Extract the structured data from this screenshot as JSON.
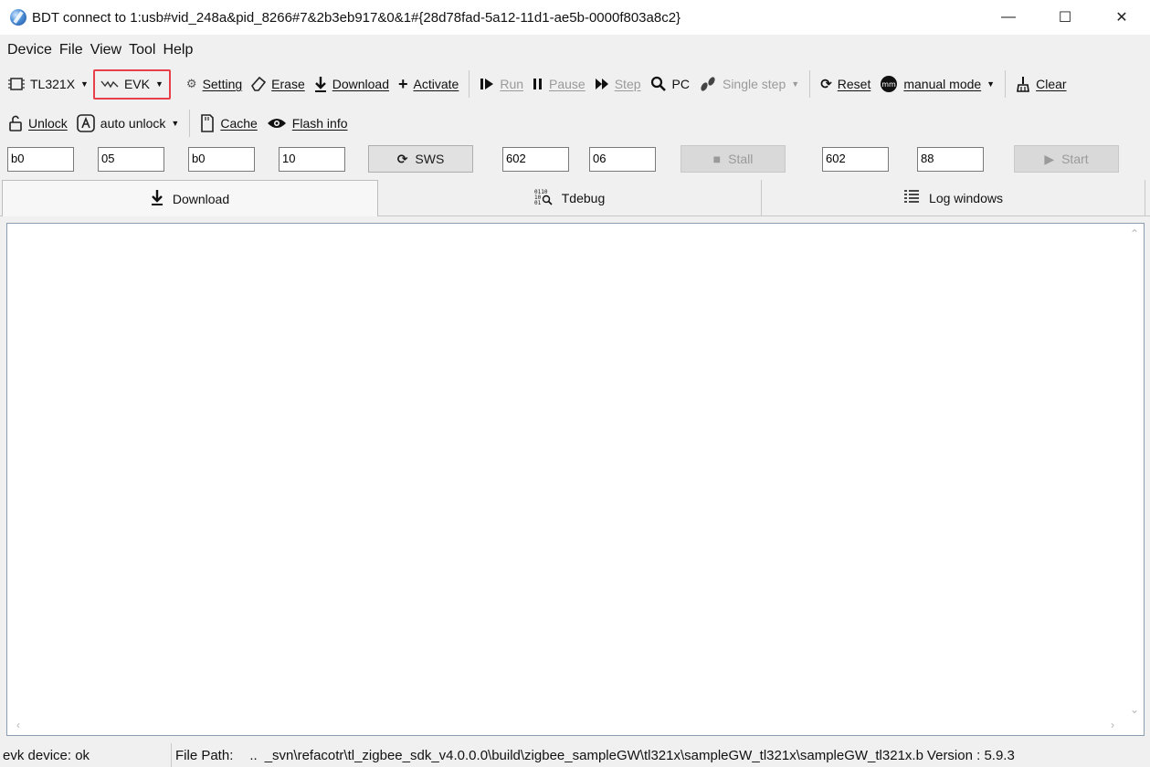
{
  "window": {
    "title": "BDT connect to 1:usb#vid_248a&pid_8266#7&2b3eb917&0&1#{28d78fad-5a12-11d1-ae5b-0000f803a8c2}",
    "minimize": "—",
    "maximize": "☐",
    "close": "✕"
  },
  "menu": {
    "items": [
      "Device",
      "File",
      "View",
      "Tool",
      "Help"
    ]
  },
  "toolbar1": {
    "chip": {
      "label": "TL321X",
      "icon": "chip-icon"
    },
    "evk": {
      "label": "EVK",
      "icon": "signal-wave-icon"
    },
    "setting": {
      "label": "Setting",
      "icon": "gear-icon"
    },
    "erase": {
      "label": "Erase",
      "icon": "eraser-icon"
    },
    "download": {
      "label": "Download",
      "icon": "download-arrow-icon"
    },
    "activate": {
      "label": "Activate",
      "icon": "plus-icon"
    },
    "run": {
      "label": "Run",
      "icon": "play-bar-icon"
    },
    "pause": {
      "label": "Pause",
      "icon": "pause-icon"
    },
    "step": {
      "label": "Step",
      "icon": "fast-forward-icon"
    },
    "pc": {
      "label": "PC",
      "icon": "magnifier-icon"
    },
    "single_step": {
      "label": "Single step",
      "icon": "footsteps-icon"
    },
    "reset": {
      "label": "Reset",
      "icon": "refresh-icon"
    },
    "manual_mode": {
      "label": "manual mode",
      "icon": "mode-badge-icon"
    },
    "clear": {
      "label": "Clear",
      "icon": "broom-icon"
    }
  },
  "toolbar2": {
    "unlock": {
      "label": "Unlock",
      "icon": "unlock-icon"
    },
    "auto_unlock": {
      "label": "auto unlock",
      "icon": "auto-lock-icon"
    },
    "cache": {
      "label": "Cache",
      "icon": "sd-card-icon"
    },
    "flash_info": {
      "label": "Flash info",
      "icon": "eye-icon"
    }
  },
  "registers": {
    "f1": "b0",
    "f2": "05",
    "f3": "b0",
    "f4": "10",
    "sws_label": "SWS",
    "f5": "602",
    "f6": "06",
    "stall_label": "Stall",
    "f7": "602",
    "f8": "88",
    "start_label": "Start"
  },
  "tabs": [
    {
      "label": "Download",
      "icon": "download-arrow-icon",
      "active": true
    },
    {
      "label": "Tdebug",
      "icon": "binary-search-icon",
      "active": false
    },
    {
      "label": "Log windows",
      "icon": "list-icon",
      "active": false
    }
  ],
  "status": {
    "device": "evk device: ok",
    "file_path_label": "File Path:",
    "file_path_prefix": "..",
    "file_path": "_svn\\refacotr\\tl_zigbee_sdk_v4.0.0.0\\build\\zigbee_sampleGW\\tl321x\\sampleGW_tl321x\\sampleGW_tl321x.b",
    "version": "Version : 5.9.3"
  }
}
